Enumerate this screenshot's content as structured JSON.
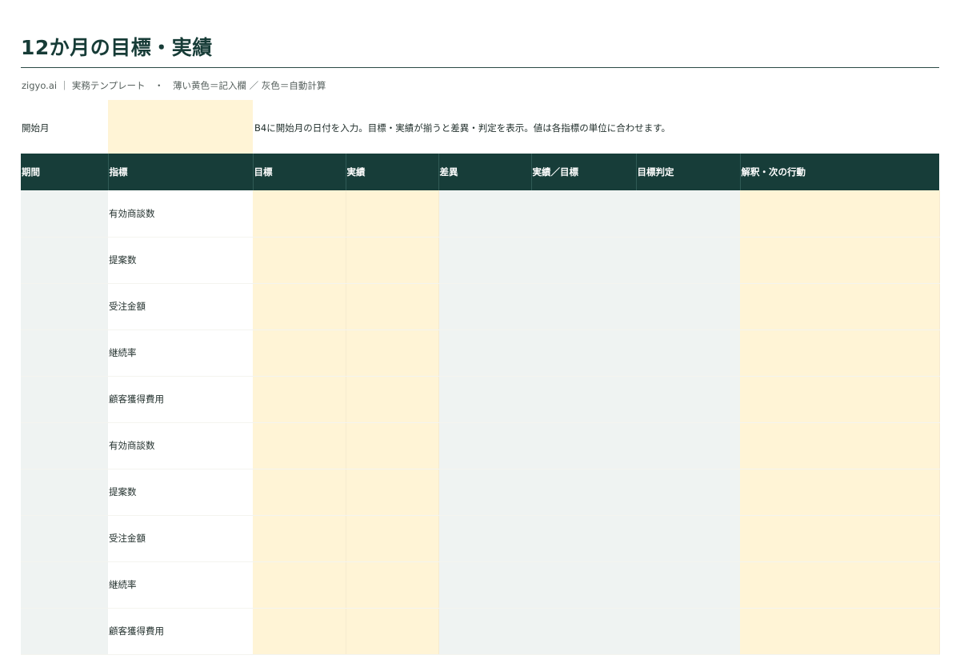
{
  "sheet": {
    "title": "12か月の目標・実績",
    "subtitle": "zigyo.ai ｜ 実務テンプレート　・　薄い黄色＝記入欄 ／ 灰色＝自動計算",
    "start_label": "開始月",
    "start_value": "",
    "start_note": "B4に開始月の日付を入力。目標・実績が揃うと差異・判定を表示。値は各指標の単位に合わせます。"
  },
  "colors": {
    "header_bg": "#173d39",
    "entry_bg": "#fff4d6",
    "calc_bg": "#eff3f2",
    "title": "#173c37"
  },
  "table": {
    "headers": [
      "期間",
      "指標",
      "目標",
      "実績",
      "差異",
      "実績／目標",
      "目標判定",
      "解釈・次の行動"
    ],
    "rows": [
      {
        "period": "",
        "metric": "有効商談数",
        "target": "",
        "actual": "",
        "diff": "",
        "ratio": "",
        "judge": "",
        "action": ""
      },
      {
        "period": "",
        "metric": "提案数",
        "target": "",
        "actual": "",
        "diff": "",
        "ratio": "",
        "judge": "",
        "action": ""
      },
      {
        "period": "",
        "metric": "受注金額",
        "target": "",
        "actual": "",
        "diff": "",
        "ratio": "",
        "judge": "",
        "action": ""
      },
      {
        "period": "",
        "metric": "継続率",
        "target": "",
        "actual": "",
        "diff": "",
        "ratio": "",
        "judge": "",
        "action": ""
      },
      {
        "period": "",
        "metric": "顧客獲得費用",
        "target": "",
        "actual": "",
        "diff": "",
        "ratio": "",
        "judge": "",
        "action": ""
      },
      {
        "period": "",
        "metric": "有効商談数",
        "target": "",
        "actual": "",
        "diff": "",
        "ratio": "",
        "judge": "",
        "action": ""
      },
      {
        "period": "",
        "metric": "提案数",
        "target": "",
        "actual": "",
        "diff": "",
        "ratio": "",
        "judge": "",
        "action": ""
      },
      {
        "period": "",
        "metric": "受注金額",
        "target": "",
        "actual": "",
        "diff": "",
        "ratio": "",
        "judge": "",
        "action": ""
      },
      {
        "period": "",
        "metric": "継続率",
        "target": "",
        "actual": "",
        "diff": "",
        "ratio": "",
        "judge": "",
        "action": ""
      },
      {
        "period": "",
        "metric": "顧客獲得費用",
        "target": "",
        "actual": "",
        "diff": "",
        "ratio": "",
        "judge": "",
        "action": ""
      }
    ]
  }
}
